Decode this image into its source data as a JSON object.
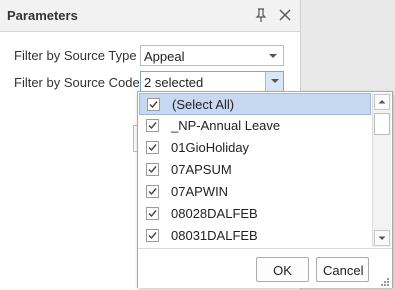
{
  "panel": {
    "title": "Parameters"
  },
  "filters": [
    {
      "label": "Filter by Source Type",
      "value": "Appeal"
    },
    {
      "label": "Filter by Source Code",
      "value": "2 selected"
    }
  ],
  "dropdown": {
    "items": [
      {
        "label": "(Select All)",
        "checked": true
      },
      {
        "label": "_NP-Annual Leave",
        "checked": true
      },
      {
        "label": "01GioHoliday",
        "checked": true
      },
      {
        "label": "07APSUM",
        "checked": true
      },
      {
        "label": "07APWIN",
        "checked": true
      },
      {
        "label": "08028DALFEB",
        "checked": true
      },
      {
        "label": "08031DALFEB",
        "checked": true
      }
    ],
    "ok_label": "OK",
    "cancel_label": "Cancel"
  }
}
